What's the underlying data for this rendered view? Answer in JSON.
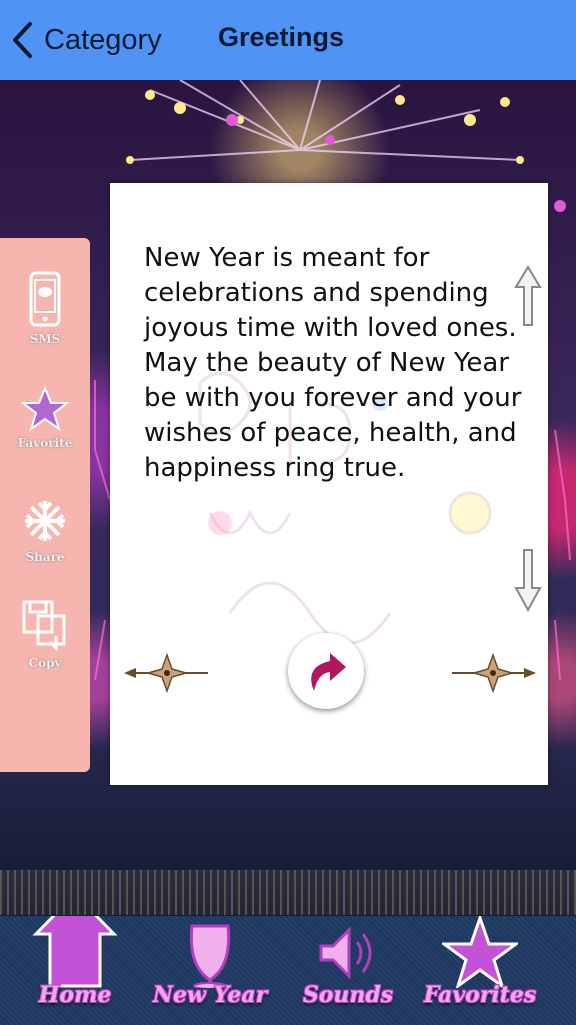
{
  "navbar": {
    "back_label": "Category",
    "title": "Greetings"
  },
  "sidebar": {
    "items": [
      {
        "label": "SMS",
        "icon": "phone-icon"
      },
      {
        "label": "Favorite",
        "icon": "star-icon"
      },
      {
        "label": "Share",
        "icon": "share-icon"
      },
      {
        "label": "Copy",
        "icon": "copy-icon"
      }
    ]
  },
  "card": {
    "message": "New Year is meant for celebrations and spending joyous time with loved ones. May the beauty of New Year be with you forever and your wishes of peace, health, and happiness ring true."
  },
  "tabbar": {
    "items": [
      {
        "label": "Home",
        "icon": "home-icon"
      },
      {
        "label": "New Year",
        "icon": "wine-glass-icon"
      },
      {
        "label": "Sounds",
        "icon": "speaker-icon"
      },
      {
        "label": "Favorites",
        "icon": "star-icon"
      }
    ]
  },
  "colors": {
    "navbar": "#4f93f4",
    "sidebar": "#f7b5b0",
    "accent": "#c452d6",
    "tabbar": "#1d3760"
  }
}
